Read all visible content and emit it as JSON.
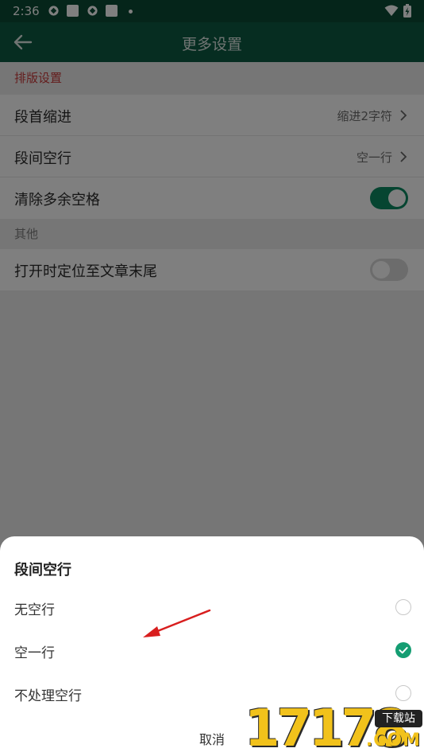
{
  "status_bar": {
    "time": "2:36"
  },
  "app_bar": {
    "title": "更多设置",
    "back_icon": "arrow-left-icon"
  },
  "sections": {
    "layout": {
      "header": "排版设置",
      "indent": {
        "label": "段首缩进",
        "value": "缩进2字符"
      },
      "spacing": {
        "label": "段间空行",
        "value": "空一行"
      },
      "clean_spaces": {
        "label": "清除多余空格",
        "enabled": true
      }
    },
    "other": {
      "header": "其他",
      "open_at_end": {
        "label": "打开时定位至文章末尾",
        "enabled": false
      }
    }
  },
  "sheet": {
    "title": "段间空行",
    "options": [
      {
        "label": "无空行",
        "selected": false
      },
      {
        "label": "空一行",
        "selected": true
      },
      {
        "label": "不处理空行",
        "selected": false
      }
    ],
    "cancel_label": "取消"
  },
  "watermark": {
    "digits": "17178",
    "badge": "下载站",
    "suffix": ".COM"
  },
  "colors": {
    "app_bar": "#0d5a42",
    "status_bar": "#0b4a35",
    "accent": "#149d72",
    "section_header_red": "#c83a3a",
    "annotation_arrow": "#d81e1e"
  }
}
